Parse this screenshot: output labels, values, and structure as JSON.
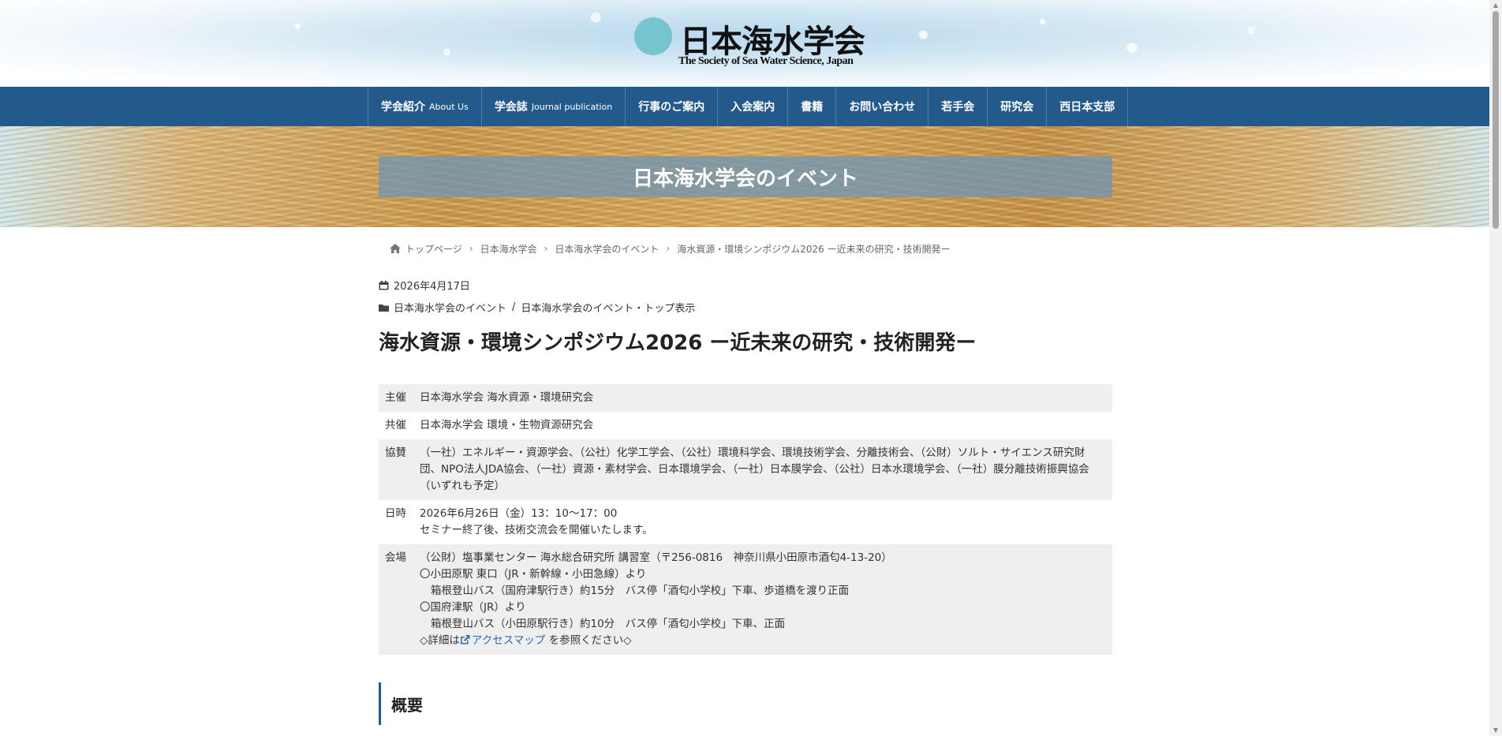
{
  "header": {
    "logo_jp": "日本海水学会",
    "logo_en": "The Society of Sea Water Science, Japan"
  },
  "nav": {
    "items": [
      {
        "label": "学会紹介",
        "sub": "About Us"
      },
      {
        "label": "学会誌",
        "sub": "Journal publication"
      },
      {
        "label": "行事のご案内",
        "sub": ""
      },
      {
        "label": "入会案内",
        "sub": ""
      },
      {
        "label": "書籍",
        "sub": ""
      },
      {
        "label": "お問い合わせ",
        "sub": ""
      },
      {
        "label": "若手会",
        "sub": ""
      },
      {
        "label": "研究会",
        "sub": ""
      },
      {
        "label": "西日本支部",
        "sub": ""
      }
    ]
  },
  "banner": {
    "title": "日本海水学会のイベント"
  },
  "breadcrumb": {
    "items": [
      "トップページ",
      "日本海水学会",
      "日本海水学会のイベント",
      "海水資源・環境シンポジウム2026 ー近未来の研究・技術開発ー"
    ]
  },
  "meta": {
    "date": "2026年4月17日",
    "categories": [
      "日本海水学会のイベント",
      "日本海水学会のイベント・トップ表示"
    ],
    "category_sep": "/"
  },
  "title": "海水資源・環境シンポジウム2026 ー近未来の研究・技術開発ー",
  "info": {
    "host": {
      "label": "主催",
      "value": "日本海水学会 海水資源・環境研究会"
    },
    "cohost": {
      "label": "共催",
      "value": "日本海水学会 環境・生物資源研究会"
    },
    "support": {
      "label": "協賛",
      "value": "（一社）エネルギー・資源学会、（公社）化学工学会、（公社）環境科学会、環境技術学会、分離技術会、（公財）ソルト・サイエンス研究財団、NPO法人JDA協会、（一社）資源・素材学会、日本環境学会、（一社）日本膜学会、（公社）日本水環境学会、（一社）膜分離技術振興協会（いずれも予定）"
    },
    "datetime": {
      "label": "日時",
      "line1": "2026年6月26日（金）13：10〜17：00",
      "line2": "セミナー終了後、技術交流会を開催いたします。"
    },
    "venue": {
      "label": "会場",
      "line1": "（公財）塩事業センター 海水総合研究所 講習室（〒256-0816　神奈川県小田原市酒匂4-13-20）",
      "line2": "〇小田原駅 東口（JR・新幹線・小田急線）より",
      "line3": "箱根登山バス（国府津駅行き）約15分　バス停「酒匂小学校」下車、歩道橋を渡り正面",
      "line4": "〇国府津駅（JR）より",
      "line5": "箱根登山バス（小田原駅行き）約10分　バス停「酒匂小学校」下車、正面",
      "detail_prefix": "◇詳細は",
      "access_link": "アクセスマップ",
      "detail_suffix": " を参照ください◇"
    }
  },
  "section": {
    "heading": "概要"
  },
  "colors": {
    "nav_bg": "#235a8c",
    "logo_circle": "#76c4cd",
    "link": "#2b6ab1",
    "row_shade": "#efefef"
  },
  "icons": [
    "home-icon",
    "calendar-icon",
    "folder-icon",
    "external-link-icon",
    "chevron-right-icon"
  ]
}
